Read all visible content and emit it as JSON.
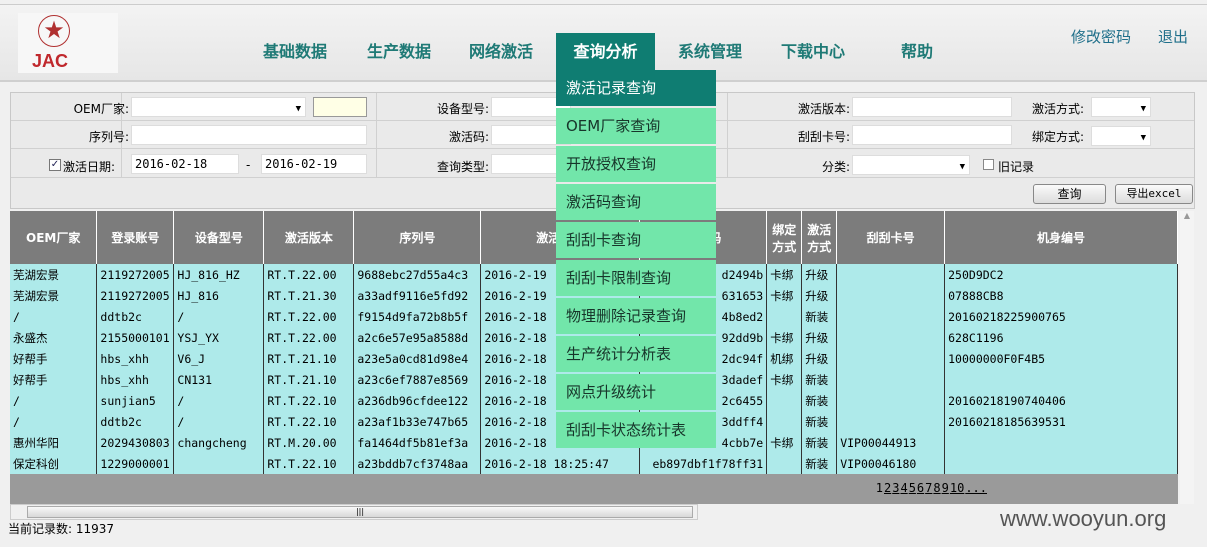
{
  "header": {
    "logo_text": "JAC",
    "nav": [
      "基础数据",
      "生产数据",
      "网络激活",
      "查询分析",
      "系统管理",
      "下载中心",
      "帮助"
    ],
    "active_nav": "查询分析",
    "change_password": "修改密码",
    "logout": "退出"
  },
  "menu": [
    "激活记录查询",
    "OEM厂家查询",
    "开放授权查询",
    "激活码查询",
    "刮刮卡查询",
    "刮刮卡限制查询",
    "物理删除记录查询",
    "生产统计分析表",
    "网点升级统计",
    "刮刮卡状态统计表"
  ],
  "form": {
    "oem_label": "OEM厂家:",
    "serial_label": "序列号:",
    "date_label": "激活日期:",
    "date_checked": true,
    "date_from": "2016-02-18",
    "date_sep": "-",
    "date_to": "2016-02-19",
    "device_label": "设备型号:",
    "code_label": "激活码:",
    "query_type_label": "查询类型:",
    "version_label": "激活版本:",
    "card_label": "刮刮卡号:",
    "category_label": "分类:",
    "old_record_label": "旧记录",
    "act_method_label": "激活方式:",
    "bind_method_label": "绑定方式:",
    "query_button": "查询",
    "export_button": "导出excel"
  },
  "table": {
    "headers": [
      "OEM厂家",
      "登录账号",
      "设备型号",
      "激活版本",
      "序列号",
      "激活时间",
      "激活码",
      "绑定方式",
      "激活方式",
      "刮刮卡号",
      "机身编号"
    ],
    "rows": [
      [
        "芜湖宏景",
        "2119272005",
        "HJ_816_HZ",
        "RT.T.22.00",
        "9688ebc27d55a4c3",
        "2016-2-19",
        "d2494b",
        "卡绑",
        "升级",
        "",
        "250D9DC2"
      ],
      [
        "芜湖宏景",
        "2119272005",
        "HJ_816",
        "RT.T.21.30",
        "a33adf9116e5fd92",
        "2016-2-19",
        "631653",
        "卡绑",
        "升级",
        "",
        "07888CB8"
      ],
      [
        "/",
        "ddtb2c",
        "/",
        "RT.T.22.00",
        "f9154d9fa72b8b5f",
        "2016-2-18",
        "4b8ed2",
        "",
        "新装",
        "",
        "20160218225900765"
      ],
      [
        "永盛杰",
        "2155000101",
        "YSJ_YX",
        "RT.T.22.00",
        "a2c6e57e95a8588d",
        "2016-2-18",
        "92dd9b",
        "卡绑",
        "升级",
        "",
        "628C1196"
      ],
      [
        "好帮手",
        "hbs_xhh",
        "V6_J",
        "RT.T.21.10",
        "a23e5a0cd81d98e4",
        "2016-2-18",
        "2dc94f",
        "机绑",
        "升级",
        "",
        "10000000F0F4B5"
      ],
      [
        "好帮手",
        "hbs_xhh",
        "CN131",
        "RT.T.21.10",
        "a23c6ef7887e8569",
        "2016-2-18",
        "3dadef",
        "卡绑",
        "新装",
        "",
        ""
      ],
      [
        "/",
        "sunjian5",
        "/",
        "RT.T.22.10",
        "a236db96cfdee122",
        "2016-2-18",
        "2c6455",
        "",
        "新装",
        "",
        "20160218190740406"
      ],
      [
        "/",
        "ddtb2c",
        "/",
        "RT.T.22.10",
        "a23af1b33e747b65",
        "2016-2-18",
        "3ddff4",
        "",
        "新装",
        "",
        "20160218185639531"
      ],
      [
        "惠州华阳",
        "2029430803",
        "changcheng",
        "RT.M.20.00",
        "fa1464df5b81ef3a",
        "2016-2-18",
        "4cbb7e",
        "卡绑",
        "新装",
        "VIP00044913",
        ""
      ],
      [
        "保定科创",
        "1229000001",
        "",
        "RT.T.22.10",
        "a23bddb7cf3748aa",
        "2016-2-18 18:25:47",
        "eb897dbf1f78ff31",
        "",
        "新装",
        "VIP00046180",
        ""
      ]
    ]
  },
  "pager": {
    "pages": [
      "1",
      "2",
      "3",
      "4",
      "5",
      "6",
      "7",
      "8",
      "9",
      "10",
      "..."
    ],
    "current": "1"
  },
  "status": "当前记录数: 11937",
  "watermark": "www.wooyun.org"
}
